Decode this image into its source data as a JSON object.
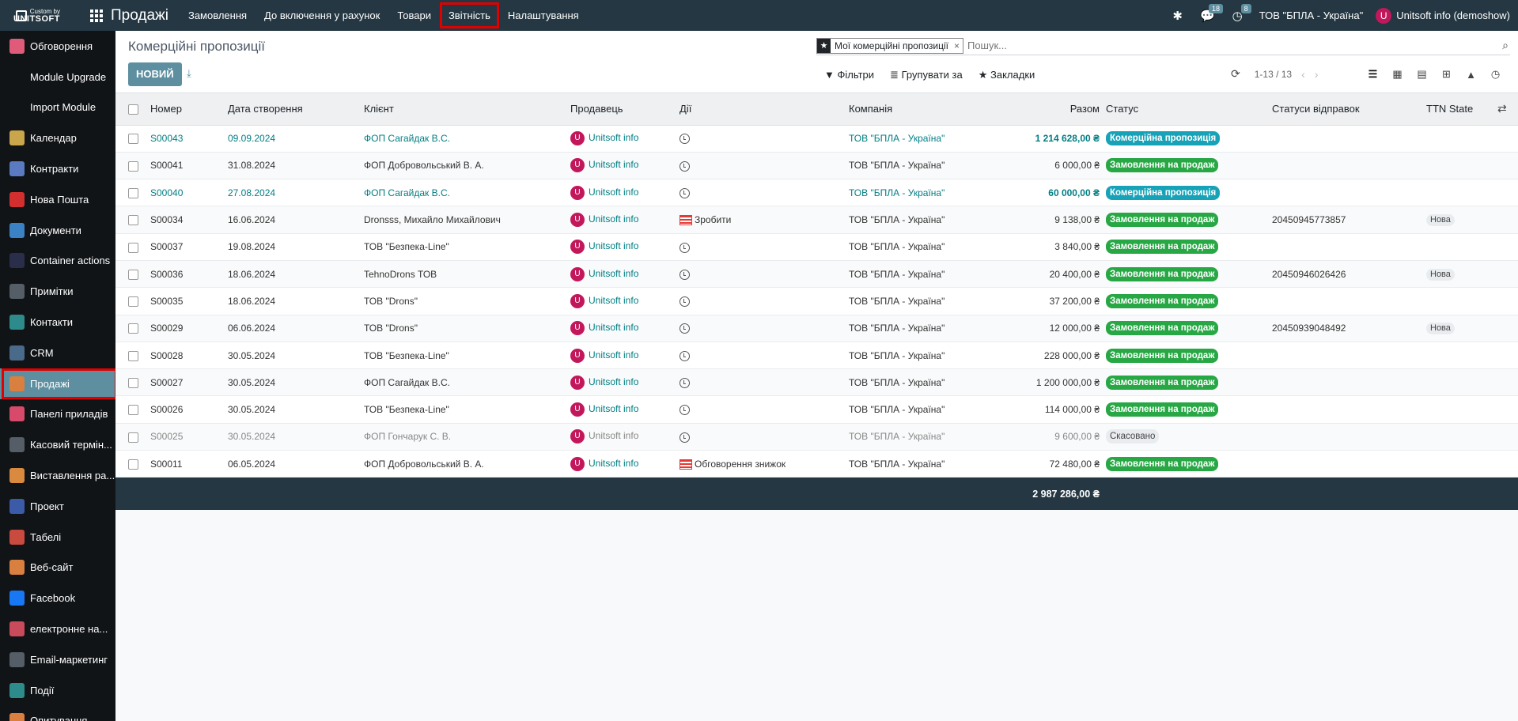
{
  "topbar": {
    "brand_line1": "Custom by",
    "brand_line2": "UNITSOFT",
    "app_title": "Продажі",
    "menu": [
      "Замовлення",
      "До включення у рахунок",
      "Товари",
      "Звітність",
      "Налаштування"
    ],
    "messages_count": "18",
    "activities_count": "8",
    "company": "ТОВ \"БПЛА - Україна\"",
    "user_initial": "U",
    "user_name": "Unitsoft info (demoshow)"
  },
  "sidebar": {
    "items": [
      {
        "label": "Обговорення",
        "icon": "chat-icon",
        "color": "#e05a7a"
      },
      {
        "label": "Module Upgrade",
        "icon": "blank",
        "color": ""
      },
      {
        "label": "Import Module",
        "icon": "blank",
        "color": ""
      },
      {
        "label": "Календар",
        "icon": "calendar-icon",
        "color": "#c9a54b"
      },
      {
        "label": "Контракти",
        "icon": "contract-icon",
        "color": "#5a7ac2"
      },
      {
        "label": "Нова Пошта",
        "icon": "nova-poshta-icon",
        "color": "#d32f2f"
      },
      {
        "label": "Документи",
        "icon": "documents-icon",
        "color": "#3b82c4"
      },
      {
        "label": "Container actions",
        "icon": "container-icon",
        "color": "#2b2e4a"
      },
      {
        "label": "Примітки",
        "icon": "notes-icon",
        "color": "#555e66"
      },
      {
        "label": "Контакти",
        "icon": "contacts-icon",
        "color": "#2e8b8b"
      },
      {
        "label": "CRM",
        "icon": "crm-icon",
        "color": "#4a6a8a"
      },
      {
        "label": "Продажі",
        "icon": "sales-icon",
        "color": "#d97f3f"
      },
      {
        "label": "Панелі приладів",
        "icon": "dashboard-icon",
        "color": "#d84a6a"
      },
      {
        "label": "Касовий термін...",
        "icon": "pos-icon",
        "color": "#555e66"
      },
      {
        "label": "Виставлення ра...",
        "icon": "invoicing-icon",
        "color": "#d98a3f"
      },
      {
        "label": "Проект",
        "icon": "project-icon",
        "color": "#3b5ba9"
      },
      {
        "label": "Табелі",
        "icon": "timesheet-icon",
        "color": "#c94a3f"
      },
      {
        "label": "Веб-сайт",
        "icon": "website-icon",
        "color": "#d97f3f"
      },
      {
        "label": "Facebook",
        "icon": "facebook-icon",
        "color": "#1877f2"
      },
      {
        "label": "електронне на...",
        "icon": "elearning-icon",
        "color": "#c94a5a"
      },
      {
        "label": "Email-маркетинг",
        "icon": "email-icon",
        "color": "#555e66"
      },
      {
        "label": "Події",
        "icon": "events-icon",
        "color": "#2e8b8b"
      },
      {
        "label": "Опитування",
        "icon": "survey-icon",
        "color": "#d97f3f"
      }
    ],
    "active_index": 11
  },
  "control_panel": {
    "breadcrumb": "Комерційні пропозиції",
    "new_button": "НОВИЙ",
    "facet": "Мої комерційні пропозиції",
    "search_placeholder": "Пошук...",
    "filters_label": "Фільтри",
    "group_by_label": "Групувати за",
    "bookmarks_label": "Закладки",
    "pager": "1-13 / 13"
  },
  "table": {
    "headers": {
      "number": "Номер",
      "date": "Дата створення",
      "customer": "Клієнт",
      "salesperson": "Продавець",
      "activities": "Дії",
      "company": "Компанія",
      "total": "Разом",
      "status": "Статус",
      "delivery_status": "Статуси відправок",
      "ttn_state": "TTN State"
    },
    "rows": [
      {
        "number": "S00043",
        "date": "09.09.2024",
        "customer": "ФОП Сагайдак В.С.",
        "salesperson": "Unitsoft info",
        "activity": "",
        "company": "ТОВ \"БПЛА - Україна\"",
        "total": "1 214 628,00 ₴",
        "status": "Комерційна пропозиція",
        "status_type": "blue",
        "delivery": "",
        "ttn": "",
        "style": "link"
      },
      {
        "number": "S00041",
        "date": "31.08.2024",
        "customer": "ФОП Добровольський В. А.",
        "salesperson": "Unitsoft info",
        "activity": "",
        "company": "ТОВ \"БПЛА - Україна\"",
        "total": "6 000,00 ₴",
        "status": "Замовлення на продаж",
        "status_type": "green",
        "delivery": "",
        "ttn": "",
        "style": ""
      },
      {
        "number": "S00040",
        "date": "27.08.2024",
        "customer": "ФОП Сагайдак В.С.",
        "salesperson": "Unitsoft info",
        "activity": "",
        "company": "ТОВ \"БПЛА - Україна\"",
        "total": "60 000,00 ₴",
        "status": "Комерційна пропозиція",
        "status_type": "blue",
        "delivery": "",
        "ttn": "",
        "style": "link"
      },
      {
        "number": "S00034",
        "date": "16.06.2024",
        "customer": "Dronsss, Михайло Михайлович",
        "salesperson": "Unitsoft info",
        "activity": "Зробити",
        "company": "ТОВ \"БПЛА - Україна\"",
        "total": "9 138,00 ₴",
        "status": "Замовлення на продаж",
        "status_type": "green",
        "delivery": "20450945773857",
        "ttn": "Нова",
        "style": ""
      },
      {
        "number": "S00037",
        "date": "19.08.2024",
        "customer": "ТОВ \"Безпека-Line\"",
        "salesperson": "Unitsoft info",
        "activity": "",
        "company": "ТОВ \"БПЛА - Україна\"",
        "total": "3 840,00 ₴",
        "status": "Замовлення на продаж",
        "status_type": "green",
        "delivery": "",
        "ttn": "",
        "style": ""
      },
      {
        "number": "S00036",
        "date": "18.06.2024",
        "customer": "TehnoDrons ТОВ",
        "salesperson": "Unitsoft info",
        "activity": "",
        "company": "ТОВ \"БПЛА - Україна\"",
        "total": "20 400,00 ₴",
        "status": "Замовлення на продаж",
        "status_type": "green",
        "delivery": "20450946026426",
        "ttn": "Нова",
        "style": ""
      },
      {
        "number": "S00035",
        "date": "18.06.2024",
        "customer": "ТОВ \"Drons\"",
        "salesperson": "Unitsoft info",
        "activity": "",
        "company": "ТОВ \"БПЛА - Україна\"",
        "total": "37 200,00 ₴",
        "status": "Замовлення на продаж",
        "status_type": "green",
        "delivery": "",
        "ttn": "",
        "style": ""
      },
      {
        "number": "S00029",
        "date": "06.06.2024",
        "customer": "ТОВ \"Drons\"",
        "salesperson": "Unitsoft info",
        "activity": "",
        "company": "ТОВ \"БПЛА - Україна\"",
        "total": "12 000,00 ₴",
        "status": "Замовлення на продаж",
        "status_type": "green",
        "delivery": "20450939048492",
        "ttn": "Нова",
        "style": ""
      },
      {
        "number": "S00028",
        "date": "30.05.2024",
        "customer": "ТОВ \"Безпека-Line\"",
        "salesperson": "Unitsoft info",
        "activity": "",
        "company": "ТОВ \"БПЛА - Україна\"",
        "total": "228 000,00 ₴",
        "status": "Замовлення на продаж",
        "status_type": "green",
        "delivery": "",
        "ttn": "",
        "style": ""
      },
      {
        "number": "S00027",
        "date": "30.05.2024",
        "customer": "ФОП Сагайдак В.С.",
        "salesperson": "Unitsoft info",
        "activity": "",
        "company": "ТОВ \"БПЛА - Україна\"",
        "total": "1 200 000,00 ₴",
        "status": "Замовлення на продаж",
        "status_type": "green",
        "delivery": "",
        "ttn": "",
        "style": ""
      },
      {
        "number": "S00026",
        "date": "30.05.2024",
        "customer": "ТОВ \"Безпека-Line\"",
        "salesperson": "Unitsoft info",
        "activity": "",
        "company": "ТОВ \"БПЛА - Україна\"",
        "total": "114 000,00 ₴",
        "status": "Замовлення на продаж",
        "status_type": "green",
        "delivery": "",
        "ttn": "",
        "style": ""
      },
      {
        "number": "S00025",
        "date": "30.05.2024",
        "customer": "ФОП Гончарук С. В.",
        "salesperson": "Unitsoft info",
        "activity": "",
        "company": "ТОВ \"БПЛА - Україна\"",
        "total": "9 600,00 ₴",
        "status": "Скасовано",
        "status_type": "grey",
        "delivery": "",
        "ttn": "",
        "style": "cancel"
      },
      {
        "number": "S00011",
        "date": "06.05.2024",
        "customer": "ФОП Добровольський В. А.",
        "salesperson": "Unitsoft info",
        "activity": "Обговорення знижок",
        "company": "ТОВ \"БПЛА - Україна\"",
        "total": "72 480,00 ₴",
        "status": "Замовлення на продаж",
        "status_type": "green",
        "delivery": "",
        "ttn": "",
        "style": ""
      }
    ],
    "grand_total": "2 987 286,00 ₴"
  }
}
